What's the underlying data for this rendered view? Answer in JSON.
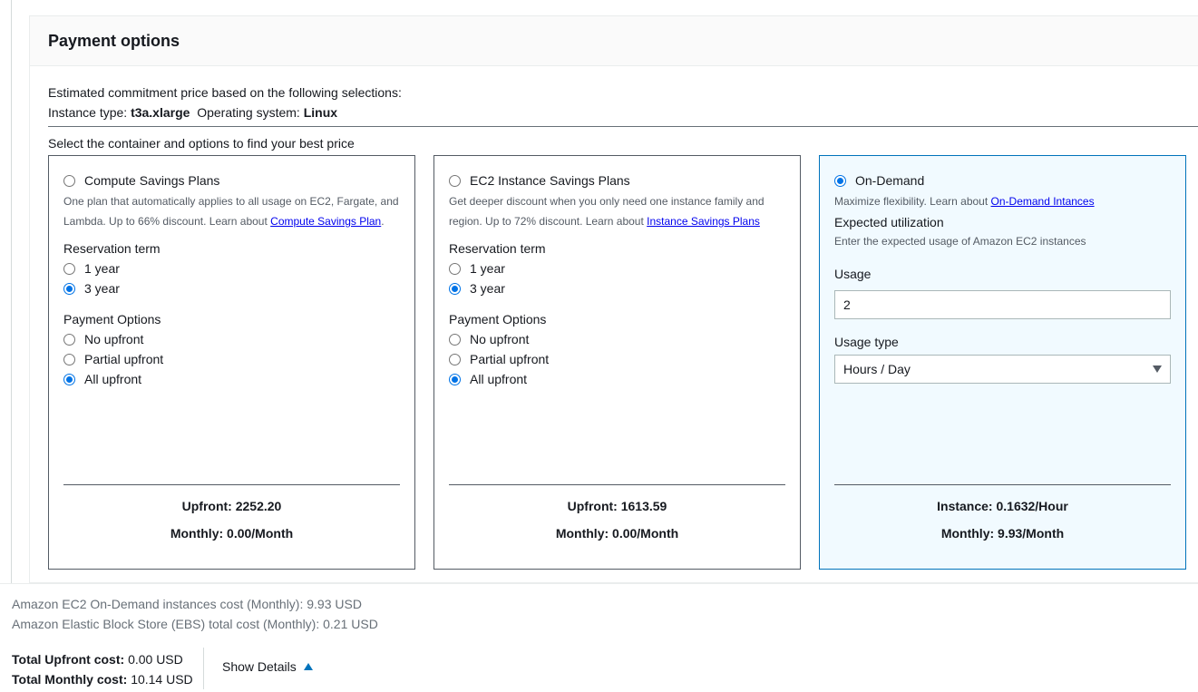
{
  "panel": {
    "title": "Payment options",
    "estimate_line": "Estimated commitment price based on the following selections:",
    "instance_type_label": "Instance type:",
    "instance_type_value": "t3a.xlarge",
    "os_label": "Operating system:",
    "os_value": "Linux",
    "select_prompt": "Select the container and options to find your best price"
  },
  "cards": {
    "compute": {
      "title": "Compute Savings Plans",
      "selected": false,
      "desc": "One plan that automatically applies to all usage on EC2, Fargate, and Lambda. Up to 66% discount. Learn about ",
      "link": "Compute Savings Plan",
      "desc_end": ".",
      "term_label": "Reservation term",
      "terms": [
        "1 year",
        "3 year"
      ],
      "term_selected": "3 year",
      "payment_label": "Payment Options",
      "payments": [
        "No upfront",
        "Partial upfront",
        "All upfront"
      ],
      "payment_selected": "All upfront",
      "upfront": "Upfront: 2252.20",
      "monthly": "Monthly: 0.00/Month"
    },
    "ec2": {
      "title": "EC2 Instance Savings Plans",
      "selected": false,
      "desc": "Get deeper discount when you only need one instance family and region. Up to 72% discount. Learn about ",
      "link": "Instance Savings Plans",
      "term_label": "Reservation term",
      "terms": [
        "1 year",
        "3 year"
      ],
      "term_selected": "3 year",
      "payment_label": "Payment Options",
      "payments": [
        "No upfront",
        "Partial upfront",
        "All upfront"
      ],
      "payment_selected": "All upfront",
      "upfront": "Upfront: 1613.59",
      "monthly": "Monthly: 0.00/Month"
    },
    "ondemand": {
      "title": "On-Demand",
      "selected": true,
      "desc": "Maximize flexibility. Learn about ",
      "link": "On-Demand Intances",
      "util_label": "Expected utilization",
      "util_sub": "Enter the expected usage of Amazon EC2 instances",
      "usage_label": "Usage",
      "usage_value": "2",
      "usage_type_label": "Usage type",
      "usage_type_value": "Hours / Day",
      "instance": "Instance: 0.1632/Hour",
      "monthly": "Monthly: 9.93/Month"
    }
  },
  "summary": {
    "ec2_cost": "Amazon EC2 On-Demand instances cost (Monthly): 9.93 USD",
    "ebs_cost": "Amazon Elastic Block Store (EBS) total cost (Monthly): 0.21 USD",
    "total_upfront_label": "Total Upfront cost:",
    "total_upfront_value": "0.00 USD",
    "total_monthly_label": "Total Monthly cost:",
    "total_monthly_value": "10.14 USD",
    "show_details": "Show Details"
  },
  "colors": {
    "accent": "#0073bb",
    "radio": "#0073e6",
    "selected_bg": "#f1faff"
  },
  "icons": {
    "show_details": "caret-up-icon",
    "select": "caret-down-icon"
  }
}
